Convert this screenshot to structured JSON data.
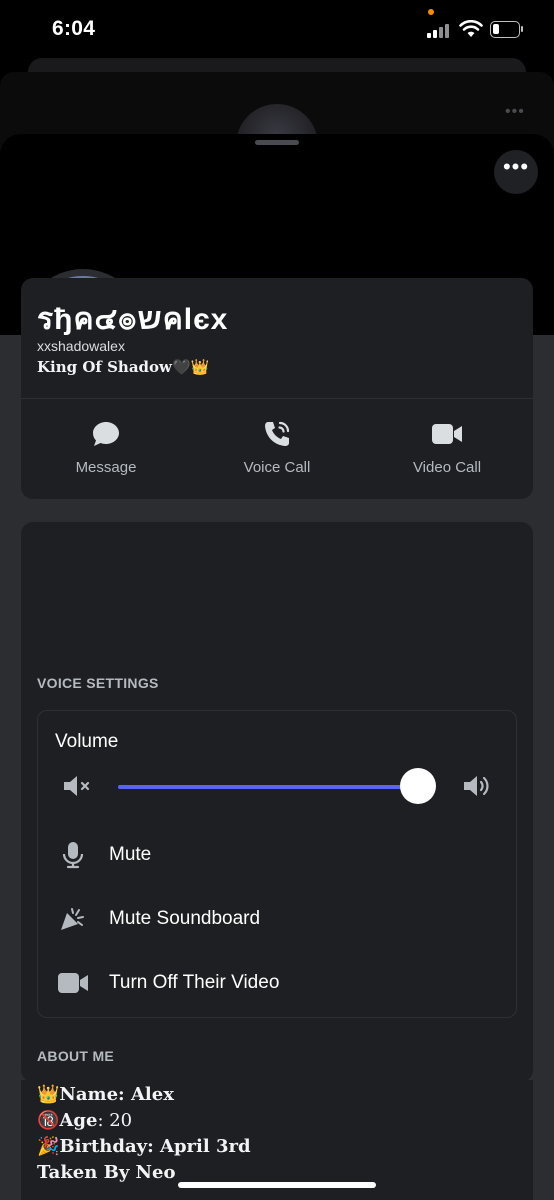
{
  "status_bar": {
    "time": "6:04"
  },
  "profile": {
    "display_name": "รђค๔๏שคlєx",
    "username": "xxshadowalex",
    "bio": "King Of Shadow🖤👑"
  },
  "actions": [
    {
      "label": "Message",
      "icon": "chat-bubble-icon"
    },
    {
      "label": "Voice Call",
      "icon": "phone-icon"
    },
    {
      "label": "Video Call",
      "icon": "video-camera-icon"
    }
  ],
  "voice_settings": {
    "title": "VOICE SETTINGS",
    "volume_label": "Volume",
    "volume_level": 1.0,
    "rows": [
      {
        "label": "Mute",
        "icon": "microphone-icon"
      },
      {
        "label": "Mute Soundboard",
        "icon": "soundboard-icon"
      },
      {
        "label": "Turn Off Their Video",
        "icon": "video-camera-icon"
      }
    ]
  },
  "about_me": {
    "title": "ABOUT ME",
    "lines": [
      {
        "emoji": "👑",
        "key": "Name",
        "value": ": Alex"
      },
      {
        "emoji": "🔞",
        "key": "Age",
        "value": ": 20"
      },
      {
        "emoji": "🎉",
        "key": "Birthday",
        "value": ": April 3rd"
      },
      {
        "emoji": "",
        "key": "Taken By Neo",
        "value": ""
      }
    ]
  },
  "colors": {
    "accent": "#5865f2",
    "background": "#2b2d31",
    "card": "#1e1f22"
  }
}
